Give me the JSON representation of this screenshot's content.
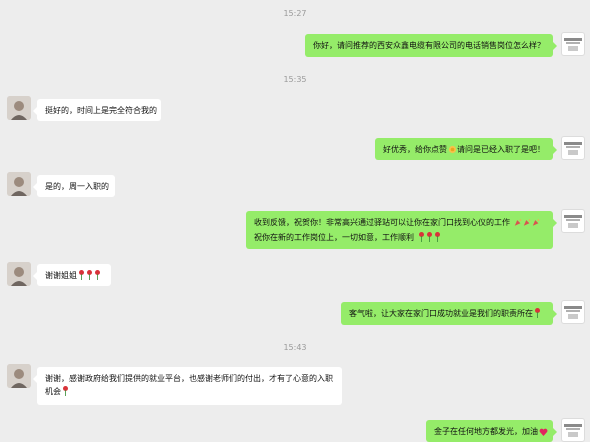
{
  "timestamps": [
    "15:27",
    "15:35",
    "15:43"
  ],
  "messages": [
    {
      "side": "right",
      "text": "你好，请问推荐的西安众鑫电缆有限公司的电话销售岗位怎么样？"
    },
    {
      "side": "left",
      "text": "挺好的，时间上是完全符合我的"
    },
    {
      "side": "right",
      "text_a": "好优秀，给你点赞",
      "emoji_a": "clap-emoji",
      "text_b": "请问是已经入职了是吧！"
    },
    {
      "side": "left",
      "text": "是的，周一入职的"
    },
    {
      "side": "right",
      "line1": "收到反馈，祝贺你！非常高兴通过驿站可以让你在家门口找到心仪的工作",
      "line2": "祝你在新的工作岗位上，一切如意，工作顺利"
    },
    {
      "side": "left",
      "text": "谢谢姐姐"
    },
    {
      "side": "right",
      "text": "客气啦，让大家在家门口成功就业是我们的职责所在"
    },
    {
      "side": "left",
      "text": "谢谢，感谢政府给我们提供的就业平台，也感谢老师们的付出，才有了心意的入职机会"
    },
    {
      "side": "right",
      "text": "金子在任何地方都发光，加油"
    }
  ],
  "icons": {
    "rose": "rose-emoji",
    "party": "party-popper-emoji",
    "heart": "heart-emoji",
    "clap": "clap-emoji"
  },
  "colors": {
    "background": "#ededed",
    "bubble_self": "#95ec69",
    "bubble_other": "#ffffff",
    "timestamp": "#9a9a9a"
  }
}
